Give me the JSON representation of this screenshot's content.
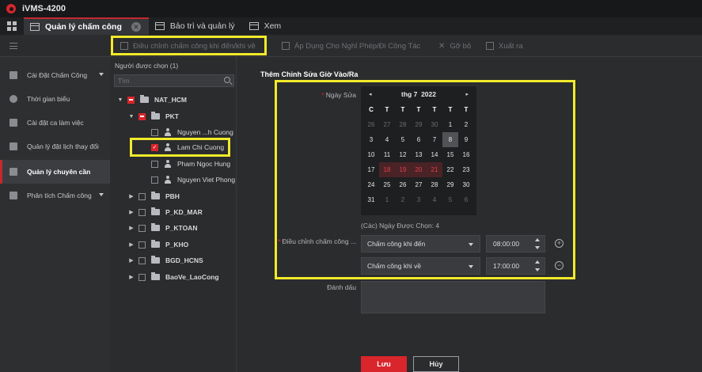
{
  "app": {
    "title": "iVMS-4200"
  },
  "tabs": [
    {
      "label": "Quản lý chấm công",
      "active": true
    },
    {
      "label": "Bảo trì và quản lý"
    },
    {
      "label": "Xem"
    }
  ],
  "toolbar": {
    "adjust_label": "Điều chỉnh chấm công khi đến/khi về",
    "apply_leave_label": "Áp Dụng Cho Nghỉ Phép/Đi Công Tác",
    "remove_label": "Gỡ bỏ",
    "export_label": "Xuất ra"
  },
  "sidebar": {
    "items": [
      {
        "label": "Cài Đặt Chấm Công",
        "icon": "settings-icon",
        "expandable": true
      },
      {
        "label": "Thời gian biểu",
        "icon": "clock-icon"
      },
      {
        "label": "Cài đặt ca làm việc",
        "icon": "shift-icon"
      },
      {
        "label": "Quản lý đặt lịch thay đổi",
        "icon": "schedule-icon"
      },
      {
        "label": "Quản lý chuyên cần",
        "icon": "attendance-icon",
        "active": true
      },
      {
        "label": "Phân tích Chấm công",
        "icon": "analysis-icon",
        "expandable": true
      }
    ]
  },
  "tree": {
    "header": "Người được chọn (1)",
    "search_placeholder": "Tìm",
    "nodes": [
      {
        "label": "NAT_HCM"
      },
      {
        "label": "PKT"
      },
      {
        "label": "Nguyen ...h Cuong"
      },
      {
        "label": "Lam Chi Cuong",
        "checked": true
      },
      {
        "label": "Pham Ngoc Hung"
      },
      {
        "label": "Nguyen Viet Phong"
      },
      {
        "label": "PBH"
      },
      {
        "label": "P_KD_MAR"
      },
      {
        "label": "P_KTOAN"
      },
      {
        "label": "P_KHO"
      },
      {
        "label": "BGD_HCNS"
      },
      {
        "label": "BaoVe_LaoCong"
      }
    ]
  },
  "form": {
    "title": "Thêm Chỉnh Sửa Giờ Vào/Ra",
    "date_label": "Ngày Sửa",
    "required_mark": "*",
    "calendar": {
      "month_label": "thg 7",
      "year_label": "2022",
      "prev": "◂",
      "next": "▸",
      "weekdays": [
        "C",
        "T",
        "T",
        "T",
        "T",
        "T",
        "T"
      ],
      "days": [
        [
          "26",
          "27",
          "28",
          "29",
          "30",
          "1",
          "2"
        ],
        [
          "3",
          "4",
          "5",
          "6",
          "7",
          "8",
          "9"
        ],
        [
          "10",
          "11",
          "12",
          "13",
          "14",
          "15",
          "16"
        ],
        [
          "17",
          "18",
          "19",
          "20",
          "21",
          "22",
          "23"
        ],
        [
          "24",
          "25",
          "26",
          "27",
          "28",
          "29",
          "30"
        ],
        [
          "31",
          "1",
          "2",
          "3",
          "4",
          "5",
          "6"
        ]
      ],
      "selected_days": [
        "18",
        "19",
        "20",
        "21"
      ],
      "today": "8"
    },
    "selected_count": "(Các) Ngày Được Chọn: 4",
    "adjust_label": "Điều chỉnh chấm công ...",
    "rows": [
      {
        "type": "Chấm công khi đến",
        "time": "08:00:00",
        "action": "+"
      },
      {
        "type": "Chấm công khi về",
        "time": "17:00:00",
        "action": "−"
      }
    ],
    "mark_label": "Đánh dấu",
    "save_label": "Lưu",
    "cancel_label": "Hủy"
  },
  "colors": {
    "accent": "#d9252c",
    "highlight": "#f2ea2a"
  }
}
